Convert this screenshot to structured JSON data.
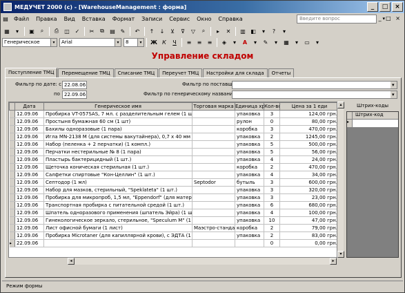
{
  "window": {
    "title": "МЕДУЧЕТ 2000 (c) - [WarehouseManagement : форма]",
    "help_placeholder": "Введите вопрос"
  },
  "menu": [
    "Файл",
    "Правка",
    "Вид",
    "Вставка",
    "Формат",
    "Записи",
    "Сервис",
    "Окно",
    "Справка"
  ],
  "formatting": {
    "style": "Генерическое",
    "font": "Arial",
    "size": "8"
  },
  "form": {
    "title": "Управление складом",
    "tabs": [
      "Поступление ТМЦ",
      "Перемещение ТМЦ",
      "Списание ТМЦ",
      "Переучет ТМЦ",
      "Настройки для склада",
      "Отчеты"
    ],
    "filter_date_label": "Фильтр по дате: с",
    "date_from": "22.08.06",
    "date_to_label": "по",
    "date_to": "22.09.06",
    "supplier_filter_label": "Фильтр по поставщику",
    "generic_filter_label": "Фильтр по генерическому названию",
    "barcodes_label": "Штрих-коды",
    "barcode_col": "Штрих-код"
  },
  "table": {
    "columns": [
      "Дата",
      "Генерическое имя",
      "Торговая марка",
      "Единица хра",
      "Кол-во",
      "Цена за 1 еди"
    ],
    "rows": [
      [
        "12.09.06",
        "Пробирка VT-057SAS, 7 мл. с разделительным гелем (1 шт.)",
        "",
        "упаковка",
        "3",
        "124,00 грн."
      ],
      [
        "12.09.06",
        "Простыня бумажная 60 см (1 шт)",
        "",
        "рулон",
        "0",
        "80,00 грн."
      ],
      [
        "12.09.06",
        "Бахилы одноразовые (1 пара)",
        "",
        "коробка",
        "3",
        "470,00 грн."
      ],
      [
        "12.09.06",
        "Игла MN-2138 M (для системы вакутайнера), 0,7 х 40 мм (1 шт.)",
        "",
        "упаковка",
        "2",
        "1245,00 грн."
      ],
      [
        "12.09.06",
        "Набор (пеленка + 2 перчатки) (1 компл.)",
        "",
        "упаковка",
        "5",
        "500,00 грн."
      ],
      [
        "12.09.06",
        "Перчатки нестерильные № 8 (1 пара)",
        "",
        "упаковка",
        "5",
        "56,00 грн."
      ],
      [
        "12.09.06",
        "Пластырь бактерицидный (1 шт.)",
        "",
        "упаковка",
        "4",
        "24,00 грн."
      ],
      [
        "12.09.06",
        "Щеточка коническая стерильная (1 шт.)",
        "",
        "коробка",
        "2",
        "470,00 грн."
      ],
      [
        "12.09.06",
        "Салфетки спиртовые \"Кон-Целлин\" (1 шт.)",
        "",
        "упаковка",
        "4",
        "34,00 грн."
      ],
      [
        "12.09.06",
        "Септодор (1 мл)",
        "Septodor",
        "бутыль",
        "3",
        "600,00 грн."
      ],
      [
        "12.09.06",
        "Набор для мазков, стерильный, \"Speklateta\" (1 шт.)",
        "",
        "упаковка",
        "3",
        "320,00 грн."
      ],
      [
        "12.09.06",
        "Пробирка для микропроб, 1,5 мл, \"Eppendorf\" (для материала на ПЦР)",
        "",
        "упаковка",
        "3",
        "23,00 грн."
      ],
      [
        "12.09.06",
        "Транспортная пробирка с питательной средой (1 шт.)",
        "",
        "упаковка",
        "6",
        "680,00 грн."
      ],
      [
        "12.09.06",
        "Шпатель одноразового применения (шпатель Эйра) (1 шт.)",
        "",
        "упаковка",
        "4",
        "100,00 грн."
      ],
      [
        "12.09.06",
        "Гинекологическое зеркало, стерильное, \"Speculum M\" (1 шт.)",
        "",
        "упаковка",
        "10",
        "47,00 грн."
      ],
      [
        "12.09.06",
        "Лист офисной бумаги (1 лист)",
        "Маэстро-стандарт",
        "коробка",
        "2",
        "79,00 грн."
      ],
      [
        "12.09.06",
        "Пробирка Microtaner (для капиллярной крови), с ЭДТА (1 шт.)",
        "",
        "упаковка",
        "2",
        "83,00 грн."
      ],
      [
        "22.09.06",
        "",
        "",
        "",
        "0",
        "0,00 грн."
      ]
    ]
  },
  "status": "Режим формы"
}
